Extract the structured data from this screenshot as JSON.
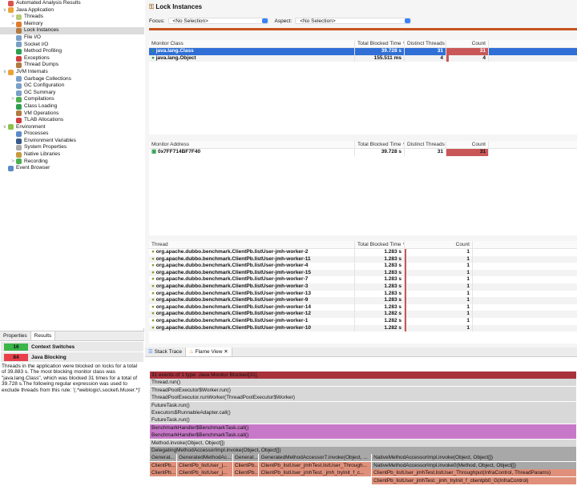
{
  "tree": [
    {
      "label": "Automated Analysis Results",
      "level": 0,
      "tw": "",
      "color": "#d9534f"
    },
    {
      "label": "Java Application",
      "level": 0,
      "tw": "∨",
      "color": "#e8a33c"
    },
    {
      "label": "Threads",
      "level": 1,
      "tw": ">",
      "color": "#b9c97a"
    },
    {
      "label": "Memory",
      "level": 1,
      "tw": ">",
      "color": "#e07c2c"
    },
    {
      "label": "Lock Instances",
      "level": 1,
      "tw": "",
      "color": "#b07a40",
      "selected": true
    },
    {
      "label": "File I/O",
      "level": 1,
      "tw": "",
      "color": "#7aa0c8"
    },
    {
      "label": "Socket I/O",
      "level": 1,
      "tw": "",
      "color": "#7aa0c8"
    },
    {
      "label": "Method Profiling",
      "level": 1,
      "tw": "",
      "color": "#2e9e4f"
    },
    {
      "label": "Exceptions",
      "level": 1,
      "tw": "",
      "color": "#d04040"
    },
    {
      "label": "Thread Dumps",
      "level": 1,
      "tw": "",
      "color": "#b07a40"
    },
    {
      "label": "JVM Internals",
      "level": 0,
      "tw": "∨",
      "color": "#e8a33c"
    },
    {
      "label": "Garbage Collections",
      "level": 1,
      "tw": "",
      "color": "#7aa0c8"
    },
    {
      "label": "GC Configuration",
      "level": 1,
      "tw": "",
      "color": "#7aa0c8"
    },
    {
      "label": "GC Summary",
      "level": 1,
      "tw": "",
      "color": "#7aa0c8"
    },
    {
      "label": "Compilations",
      "level": 1,
      "tw": ">",
      "color": "#4caf50"
    },
    {
      "label": "Class Loading",
      "level": 1,
      "tw": "",
      "color": "#2e9e4f"
    },
    {
      "label": "VM Operations",
      "level": 1,
      "tw": "",
      "color": "#b07a40"
    },
    {
      "label": "TLAB Allocations",
      "level": 1,
      "tw": "",
      "color": "#d04040"
    },
    {
      "label": "Environment",
      "level": 0,
      "tw": "∨",
      "color": "#8bc34a"
    },
    {
      "label": "Processes",
      "level": 1,
      "tw": "",
      "color": "#5b8ac8"
    },
    {
      "label": "Environment Variables",
      "level": 1,
      "tw": "",
      "color": "#3a5a8a"
    },
    {
      "label": "System Properties",
      "level": 1,
      "tw": "",
      "color": "#aaaaaa"
    },
    {
      "label": "Native Libraries",
      "level": 1,
      "tw": "",
      "color": "#c89a40"
    },
    {
      "label": "Recording",
      "level": 1,
      "tw": ">",
      "color": "#4caf50"
    },
    {
      "label": "Event Browser",
      "level": 0,
      "tw": "",
      "color": "#5b8ac8"
    }
  ],
  "bottom": {
    "tabs": [
      "Properties",
      "Results"
    ],
    "results": [
      {
        "score": "16",
        "label": "Context Switches",
        "color": "#3cb54a"
      },
      {
        "score": "84",
        "label": "Java Blocking",
        "color": "#e8404a"
      }
    ],
    "text": "Threads in the application were blocked on locks for a total of 39.883 s. The most blocking monitor class was \"java.lang.Class\", which was blocked 31 times for a total of 39.728 s.The following regular expression was used to exclude threads from this rule: '(.*weblogic\\.socket\\.Muxer.*)'"
  },
  "page": {
    "title": "Lock Instances",
    "focus_label": "Focus:",
    "focus_value": "<No Selection>",
    "aspect_label": "Aspect:",
    "aspect_value": "<No Selection>"
  },
  "monitor_class": {
    "headers": [
      "Monitor Class",
      "Total Blocked Time ∨",
      "Distinct Threads",
      "Count"
    ],
    "rows": [
      {
        "name": "java.lang.Class",
        "time": "39.728 s",
        "threads": "31",
        "count": "31",
        "frac": 1.0
      },
      {
        "name": "java.lang.Object",
        "time": "155.511 ms",
        "threads": "4",
        "count": "4",
        "frac": 0.05
      }
    ]
  },
  "monitor_address": {
    "headers": [
      "Monitor Address",
      "Total Blocked Time ∨",
      "Distinct Threads",
      "Count"
    ],
    "rows": [
      {
        "name": "0x7FF714BF7F40",
        "time": "39.728 s",
        "threads": "31",
        "count": "31",
        "frac": 1.0
      }
    ]
  },
  "threads": {
    "headers": [
      "Thread",
      "Total Blocked Time ∨",
      "Count"
    ],
    "rows": [
      {
        "name": "org.apache.dubbo.benchmark.ClientPb.listUser-jmh-worker-2",
        "time": "1.283 s",
        "count": "1"
      },
      {
        "name": "org.apache.dubbo.benchmark.ClientPb.listUser-jmh-worker-11",
        "time": "1.283 s",
        "count": "1"
      },
      {
        "name": "org.apache.dubbo.benchmark.ClientPb.listUser-jmh-worker-4",
        "time": "1.283 s",
        "count": "1"
      },
      {
        "name": "org.apache.dubbo.benchmark.ClientPb.listUser-jmh-worker-15",
        "time": "1.283 s",
        "count": "1"
      },
      {
        "name": "org.apache.dubbo.benchmark.ClientPb.listUser-jmh-worker-7",
        "time": "1.283 s",
        "count": "1"
      },
      {
        "name": "org.apache.dubbo.benchmark.ClientPb.listUser-jmh-worker-3",
        "time": "1.283 s",
        "count": "1"
      },
      {
        "name": "org.apache.dubbo.benchmark.ClientPb.listUser-jmh-worker-13",
        "time": "1.283 s",
        "count": "1"
      },
      {
        "name": "org.apache.dubbo.benchmark.ClientPb.listUser-jmh-worker-9",
        "time": "1.283 s",
        "count": "1"
      },
      {
        "name": "org.apache.dubbo.benchmark.ClientPb.listUser-jmh-worker-14",
        "time": "1.283 s",
        "count": "1"
      },
      {
        "name": "org.apache.dubbo.benchmark.ClientPb.listUser-jmh-worker-12",
        "time": "1.282 s",
        "count": "1"
      },
      {
        "name": "org.apache.dubbo.benchmark.ClientPb.listUser-jmh-worker-1",
        "time": "1.282 s",
        "count": "1"
      },
      {
        "name": "org.apache.dubbo.benchmark.ClientPb.listUser-jmh-worker-10",
        "time": "1.282 s",
        "count": "1"
      }
    ]
  },
  "flame": {
    "tabs": [
      "Stack Trace",
      "Flame View"
    ],
    "colors": {
      "root": "#a8323c",
      "grey": "#d8d8d8",
      "dark": "#a8a8a8",
      "pink": "#c878c8",
      "salmon": "#e0907a"
    },
    "frames": [
      {
        "row": 0,
        "start": 0,
        "end": 1,
        "label": "31 events of 1 type: Java Monitor Blocked[31],",
        "kind": "root"
      },
      {
        "row": 1,
        "start": 0,
        "end": 1,
        "label": "Thread.run()",
        "kind": "grey"
      },
      {
        "row": 2,
        "start": 0,
        "end": 1,
        "label": "ThreadPoolExecutor$Worker.run()",
        "kind": "grey"
      },
      {
        "row": 3,
        "start": 0,
        "end": 1,
        "label": "ThreadPoolExecutor.runWorker(ThreadPoolExecutor$Worker)",
        "kind": "grey"
      },
      {
        "row": 4,
        "start": 0,
        "end": 1,
        "label": "FutureTask.run()",
        "kind": "grey"
      },
      {
        "row": 5,
        "start": 0,
        "end": 1,
        "label": "Executors$RunnableAdapter.call()",
        "kind": "grey"
      },
      {
        "row": 6,
        "start": 0,
        "end": 1,
        "label": "FutureTask.run()",
        "kind": "grey"
      },
      {
        "row": 7,
        "start": 0,
        "end": 1,
        "label": "BenchmarkHandler$BenchmarkTask.call()",
        "kind": "pink"
      },
      {
        "row": 8,
        "start": 0,
        "end": 1,
        "label": "BenchmarkHandler$BenchmarkTask.call()",
        "kind": "pink"
      },
      {
        "row": 9,
        "start": 0,
        "end": 1,
        "label": "Method.invoke(Object, Object[])",
        "kind": "grey"
      },
      {
        "row": 10,
        "start": 0,
        "end": 1,
        "label": "DelegatingMethodAccessorImpl.invoke(Object, Object[])",
        "kind": "dark"
      },
      {
        "row": 11,
        "start": 0,
        "end": 0.064,
        "label": "Generat...",
        "kind": "dark"
      },
      {
        "row": 11,
        "start": 0.064,
        "end": 0.195,
        "label": "GeneratedMethodAc...",
        "kind": "dark"
      },
      {
        "row": 11,
        "start": 0.195,
        "end": 0.256,
        "label": "Generat...",
        "kind": "dark"
      },
      {
        "row": 11,
        "start": 0.256,
        "end": 0.52,
        "label": "GeneratedMethodAccessor7.invoke(Object, ...",
        "kind": "dark"
      },
      {
        "row": 11,
        "start": 0.52,
        "end": 1,
        "label": "NativeMethodAccessorImpl.invoke(Object, Object[])",
        "kind": "dark"
      },
      {
        "row": 12,
        "start": 0,
        "end": 0.064,
        "label": "ClientPb...",
        "kind": "salmon"
      },
      {
        "row": 12,
        "start": 0.064,
        "end": 0.195,
        "label": "ClientPb_listUser_j...",
        "kind": "salmon"
      },
      {
        "row": 12,
        "start": 0.195,
        "end": 0.256,
        "label": "ClientPb...",
        "kind": "salmon"
      },
      {
        "row": 12,
        "start": 0.256,
        "end": 0.52,
        "label": "ClientPb_listUser_jmhTest.listUser_Through...",
        "kind": "salmon"
      },
      {
        "row": 12,
        "start": 0.52,
        "end": 1,
        "label": "NativeMethodAccessorImpl.invoke0(Method, Object, Object[])",
        "kind": "dark"
      },
      {
        "row": 13,
        "start": 0,
        "end": 0.064,
        "label": "ClientPb...",
        "kind": "salmon"
      },
      {
        "row": 13,
        "start": 0.064,
        "end": 0.195,
        "label": "ClientPb_listUser_j...",
        "kind": "salmon"
      },
      {
        "row": 13,
        "start": 0.195,
        "end": 0.256,
        "label": "ClientPb...",
        "kind": "salmon"
      },
      {
        "row": 13,
        "start": 0.256,
        "end": 0.52,
        "label": "ClientPb_listUser_jmhTest._jmh_tryInit_f_c...",
        "kind": "salmon"
      },
      {
        "row": 13,
        "start": 0.52,
        "end": 1,
        "label": "ClientPb_listUser_jmhTest.listUser_Throughput(InfraControl, ThreadParams)",
        "kind": "salmon"
      },
      {
        "row": 14,
        "start": 0.52,
        "end": 1,
        "label": "ClientPb_listUser_jmhTest._jmh_tryInit_f_clientpb0_G(InfraControl)",
        "kind": "salmon"
      }
    ]
  }
}
